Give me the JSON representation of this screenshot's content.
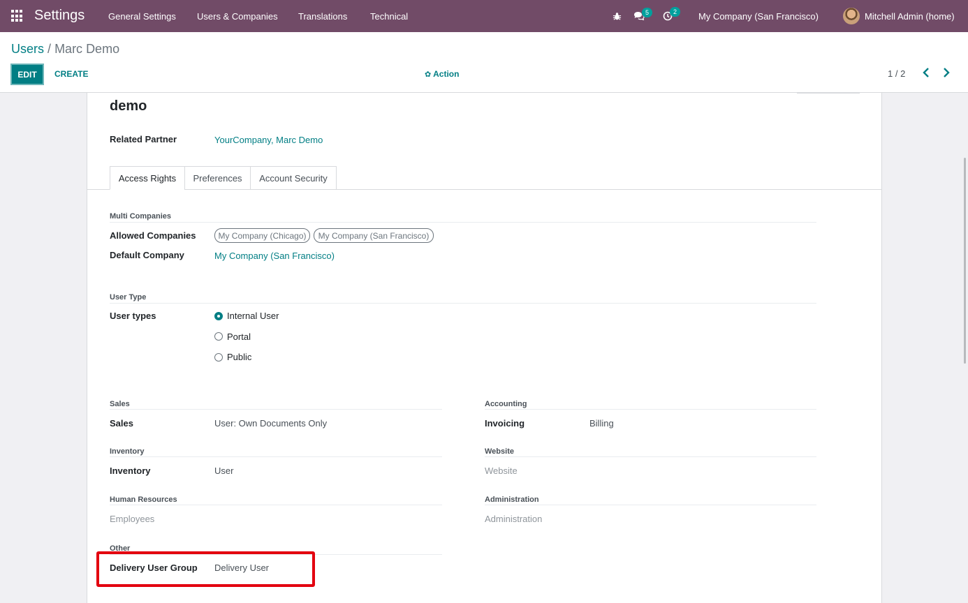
{
  "navbar": {
    "brand": "Settings",
    "menu": [
      "General Settings",
      "Users & Companies",
      "Translations",
      "Technical"
    ],
    "messages_count": "5",
    "activities_count": "2",
    "company": "My Company (San Francisco)",
    "user": "Mitchell Admin (home)"
  },
  "control_panel": {
    "breadcrumb_parent": "Users",
    "breadcrumb_separator": "/",
    "breadcrumb_current": "Marc Demo",
    "edit_label": "EDIT",
    "create_label": "CREATE",
    "action_label": "Action",
    "pager": "1 / 2"
  },
  "form": {
    "title": "demo",
    "related_partner_label": "Related Partner",
    "related_partner_value": "YourCompany, Marc Demo",
    "tabs": [
      "Access Rights",
      "Preferences",
      "Account Security"
    ],
    "multi_companies": {
      "section": "Multi Companies",
      "allowed_label": "Allowed Companies",
      "allowed_tags": [
        "My Company (Chicago)",
        "My Company (San Francisco)"
      ],
      "default_label": "Default Company",
      "default_value": "My Company (San Francisco)"
    },
    "user_type": {
      "section": "User Type",
      "label": "User types",
      "options": [
        "Internal User",
        "Portal",
        "Public"
      ],
      "selected": "Internal User"
    },
    "groups": {
      "sales_section": "Sales",
      "sales_label": "Sales",
      "sales_value": "User: Own Documents Only",
      "accounting_section": "Accounting",
      "invoicing_label": "Invoicing",
      "invoicing_value": "Billing",
      "inventory_section": "Inventory",
      "inventory_label": "Inventory",
      "inventory_value": "User",
      "website_section": "Website",
      "website_label": "Website",
      "hr_section": "Human Resources",
      "employees_label": "Employees",
      "administration_section": "Administration",
      "administration_label": "Administration",
      "other_section": "Other",
      "delivery_label": "Delivery User Group",
      "delivery_value": "Delivery User"
    }
  },
  "colors": {
    "navbar": "#714b67",
    "accent": "#017e84",
    "highlight": "#e3000f"
  }
}
